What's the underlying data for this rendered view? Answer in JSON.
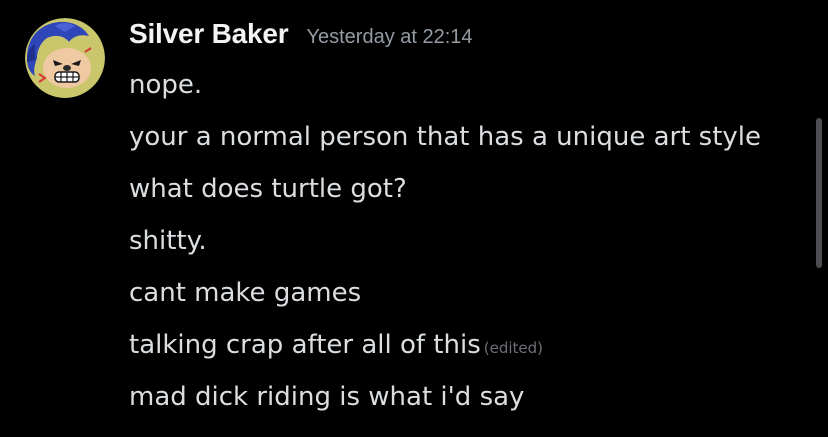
{
  "message": {
    "author": "Silver Baker",
    "timestamp": "Yesterday at 22:14",
    "avatar_icon": "cartoon-hedgehog-avatar",
    "edited_label": "(edited)",
    "lines": [
      "nope.",
      "your a normal person that has a unique art style",
      "what does turtle got?",
      "shitty.",
      "cant make games",
      "talking crap after all of this",
      "mad dick riding is what i'd say"
    ]
  },
  "colors": {
    "background": "#000000",
    "username": "#f2f3f5",
    "timestamp": "#949ba4",
    "message_text": "#dbdee1",
    "edited": "#6d6f78",
    "avatar_ring": "#c8c56a"
  }
}
